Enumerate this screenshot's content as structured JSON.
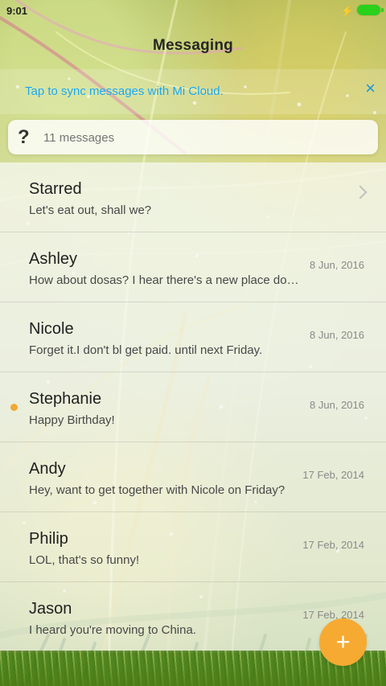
{
  "status_bar": {
    "time": "9:01",
    "battery_color": "#29d11a",
    "charging_icon": "lightning-bolt-icon"
  },
  "header": {
    "title": "Messaging"
  },
  "sync_banner": {
    "text": "Tap to sync messages with Mi Cloud.",
    "close_icon": "close-icon",
    "accent_color": "#16a6ea"
  },
  "search": {
    "icon": "question-mark-icon",
    "placeholder": "11 messages"
  },
  "messages": [
    {
      "name": "Starred",
      "preview": "Let's eat out, shall we?",
      "date": "",
      "unread": false,
      "chevron": true
    },
    {
      "name": "Ashley",
      "preview": "How about dosas? I hear there's a new place do…",
      "date": "8 Jun, 2016",
      "unread": false
    },
    {
      "name": "Nicole",
      "preview": "Forget it.I don't bl get paid. until next Friday.",
      "date": "8 Jun, 2016",
      "unread": false
    },
    {
      "name": "Stephanie",
      "preview": "Happy Birthday!",
      "date": "8 Jun, 2016",
      "unread": true,
      "dot_color": "#f2a933"
    },
    {
      "name": "Andy",
      "preview": "Hey, want to get together with Nicole on Friday?",
      "date": "17 Feb, 2014",
      "unread": false
    },
    {
      "name": "Philip",
      "preview": "LOL, that's so funny!",
      "date": "17 Feb, 2014",
      "unread": false
    },
    {
      "name": "Jason",
      "preview": "I heard you're moving to China.",
      "date": "17 Feb, 2014",
      "unread": false
    }
  ],
  "fab": {
    "label": "+",
    "icon": "plus-icon",
    "color": "#f6aa31"
  }
}
